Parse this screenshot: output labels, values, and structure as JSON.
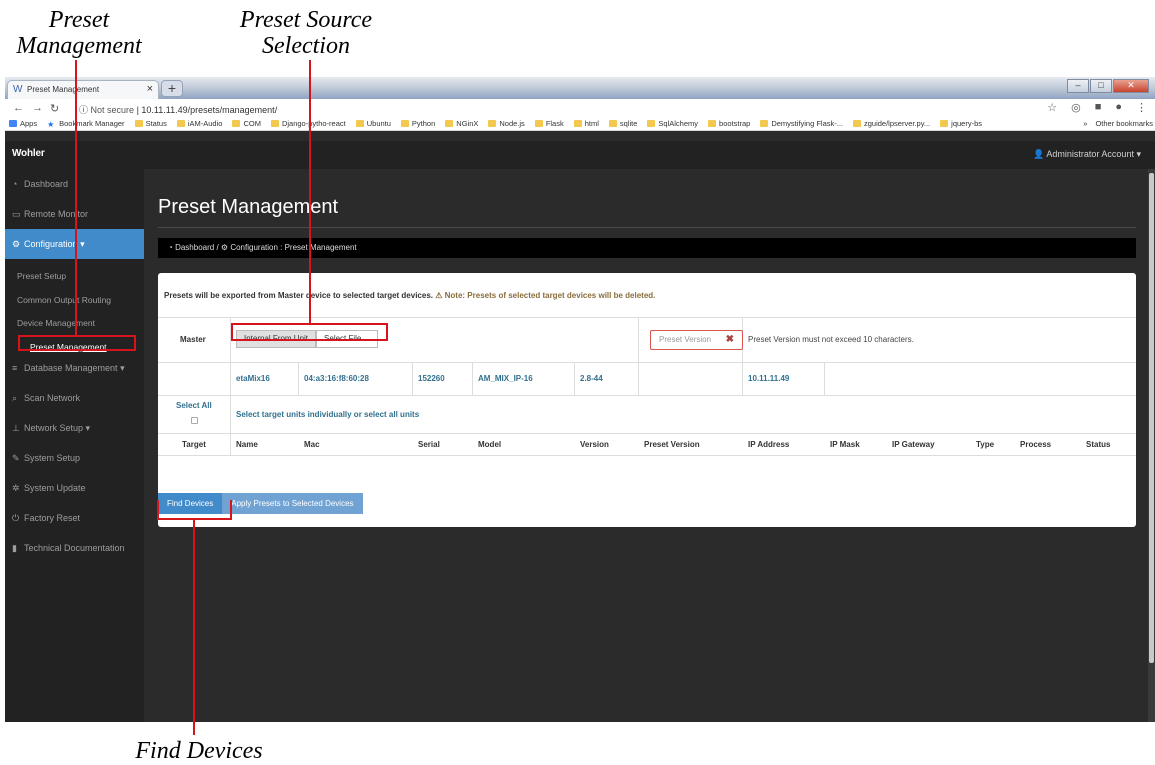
{
  "callouts": {
    "preset_management": "Preset Management",
    "preset_source": "Preset Source Selection",
    "find_devices": "Find Devices"
  },
  "browser": {
    "tab_title": "Preset Management",
    "new_tab": "+",
    "not_secure": "Not secure",
    "url_host": "10.11.11.49",
    "url_path": "/presets/management/",
    "bookmarks": [
      "Apps",
      "Bookmark Manager",
      "Status",
      "iAM-Audio",
      "COM",
      "Django-pytho-react",
      "Ubuntu",
      "Python",
      "NGinX",
      "Node.js",
      "Flask",
      "html",
      "sqlite",
      "SqlAlchemy",
      "bootstrap",
      "Demystifying Flask-...",
      "zguide/lpserver.py...",
      "jquery-bs"
    ],
    "other_bookmarks": "Other bookmarks",
    "more": "»"
  },
  "app": {
    "logo": "Wohler",
    "account": "Administrator Account"
  },
  "sidebar": {
    "items": [
      "Dashboard",
      "Remote Monitor",
      "Configuration",
      "Database Management",
      "Scan Network",
      "Network Setup",
      "System Setup",
      "System Update",
      "Factory Reset",
      "Technical Documentation"
    ],
    "sub_items": [
      "Preset Setup",
      "Common Output Routing",
      "Device Management",
      "Preset Management"
    ]
  },
  "page": {
    "title": "Preset Management",
    "breadcrumb_home": "Dashboard",
    "breadcrumb_sep": "/",
    "breadcrumb_current": "Configuration : Preset Management",
    "notice": "Presets will be exported from Master device to selected target devices.",
    "warning": "Note: Presets of selected target devices will be deleted.",
    "master_label": "Master",
    "internal_btn": "Internal From Unit",
    "select_file_btn": "Select File ...",
    "preset_version_placeholder": "Preset Version",
    "preset_version_hint": "Preset Version must not exceed 10 characters.",
    "master_row": {
      "name": "etaMix16",
      "mac": "04:a3:16:f8:60:28",
      "serial": "152260",
      "model": "AM_MIX_IP-16",
      "version": "2.8-44",
      "ip": "10.11.11.49"
    },
    "select_all": "Select All",
    "select_hint": "Select target units individually or select all units",
    "columns": [
      "Target",
      "Name",
      "Mac",
      "Serial",
      "Model",
      "Version",
      "Preset Version",
      "IP Address",
      "IP Mask",
      "IP Gateway",
      "Type",
      "Process",
      "Status"
    ],
    "find_devices_btn": "Find Devices",
    "apply_btn": "Apply Presets to Selected Devices"
  },
  "colors": {
    "accent": "#428bca",
    "callout": "#d6141b",
    "sidebar": "#222222"
  }
}
